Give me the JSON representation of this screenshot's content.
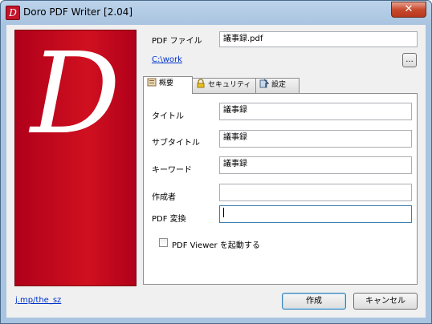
{
  "window": {
    "title": "Doro PDF Writer [2.04]",
    "close_symbol": "✕"
  },
  "banner": {
    "glyph": "D"
  },
  "output": {
    "pdf_file_label": "PDF ファイル",
    "pdf_file_value": "議事録.pdf",
    "folder_link": "C:\\work",
    "browse_label": "..."
  },
  "tabs": [
    {
      "label": "概要",
      "icon": "document-icon"
    },
    {
      "label": "セキュリティ",
      "icon": "lock-icon"
    },
    {
      "label": "設定",
      "icon": "settings-icon"
    }
  ],
  "summary": {
    "title_label": "タイトル",
    "title_value": "議事録",
    "subtitle_label": "サブタイトル",
    "subtitle_value": "議事録",
    "keyword_label": "キーワード",
    "keyword_value": "議事録",
    "author_label": "作成者",
    "author_value": "",
    "pdf_conversion_label": "PDF 変換",
    "pdf_conversion_value": "",
    "viewer_checkbox_label": "PDF Viewer を起動する",
    "viewer_checkbox_checked": false
  },
  "footer": {
    "link": "j.mp/the_sz",
    "create_button": "作成",
    "cancel_button": "キャンセル"
  }
}
